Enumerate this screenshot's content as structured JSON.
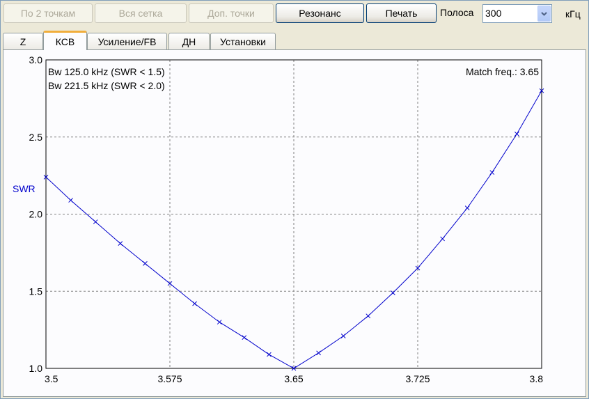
{
  "toolbar": {
    "buttons": [
      {
        "label": "По 2 точкам",
        "enabled": false
      },
      {
        "label": "Вся сетка",
        "enabled": false
      },
      {
        "label": "Доп. точки",
        "enabled": false
      },
      {
        "label": "Резонанс",
        "enabled": true
      },
      {
        "label": "Печать",
        "enabled": true
      }
    ],
    "band_label": "Полоса",
    "band_value": "300",
    "band_unit": "кГц"
  },
  "tabs": [
    {
      "label": "Z",
      "active": false
    },
    {
      "label": "КСВ",
      "active": true
    },
    {
      "label": "Усиление/FB",
      "active": false
    },
    {
      "label": "ДН",
      "active": false
    },
    {
      "label": "Установки",
      "active": false
    }
  ],
  "chart_data": {
    "type": "line",
    "ylabel": "SWR",
    "xlabel": "",
    "xlim": [
      3.5,
      3.8
    ],
    "ylim": [
      1.0,
      3.0
    ],
    "xticks": [
      "3.5",
      "3.575",
      "3.65",
      "3.725",
      "3.8"
    ],
    "yticks": [
      "1.0",
      "1.5",
      "2.0",
      "2.5",
      "3.0"
    ],
    "grid": true,
    "annotations": [
      "Bw 125.0 kHz (SWR < 1.5)",
      "Bw 221.5 kHz (SWR < 2.0)"
    ],
    "match_text": "Match freq.: 3.65",
    "line_color": "#0000cc",
    "x": [
      3.5,
      3.515,
      3.53,
      3.545,
      3.56,
      3.575,
      3.59,
      3.605,
      3.62,
      3.635,
      3.65,
      3.665,
      3.68,
      3.695,
      3.71,
      3.725,
      3.74,
      3.755,
      3.77,
      3.785,
      3.8
    ],
    "y": [
      2.24,
      2.09,
      1.95,
      1.81,
      1.68,
      1.55,
      1.42,
      1.3,
      1.2,
      1.09,
      1.0,
      1.1,
      1.21,
      1.34,
      1.49,
      1.65,
      1.84,
      2.04,
      2.27,
      2.52,
      2.8
    ]
  }
}
